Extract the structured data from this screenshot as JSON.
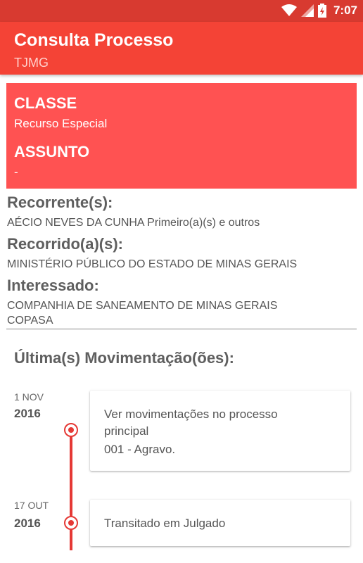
{
  "status_bar": {
    "time": "7:07",
    "icons": [
      "wifi-icon",
      "cell-signal-icon",
      "battery-charging-icon"
    ]
  },
  "app_bar": {
    "title": "Consulta Processo",
    "subtitle": "TJMG"
  },
  "classe_card": {
    "classe_label": "CLASSE",
    "classe_value": "Recurso Especial",
    "assunto_label": "ASSUNTO",
    "assunto_value": "-"
  },
  "parties": [
    {
      "heading": "Recorrente(s):",
      "value": "AÉCIO NEVES DA CUNHA Primeiro(a)(s) e outros"
    },
    {
      "heading": "Recorrido(a)(s):",
      "value": "MINISTÉRIO PÚBLICO DO ESTADO DE MINAS GERAIS"
    },
    {
      "heading": "Interessado:",
      "value_line1": "COMPANHIA DE SANEAMENTO DE MINAS GERAIS",
      "value_line2": "COPASA"
    }
  ],
  "movimentacoes": {
    "title": "Última(s) Movimentação(ões):",
    "items": [
      {
        "day": "1 NOV",
        "year": "2016",
        "lines": [
          "Ver movimentações no processo",
          "principal",
          "001 - Agravo."
        ]
      },
      {
        "day": "17 OUT",
        "year": "2016",
        "lines": [
          "Transitado em Julgado"
        ]
      }
    ]
  },
  "colors": {
    "status_bar": "#d83a30",
    "app_bar": "#f44336",
    "card": "#ff5252",
    "timeline": "#e53935"
  }
}
